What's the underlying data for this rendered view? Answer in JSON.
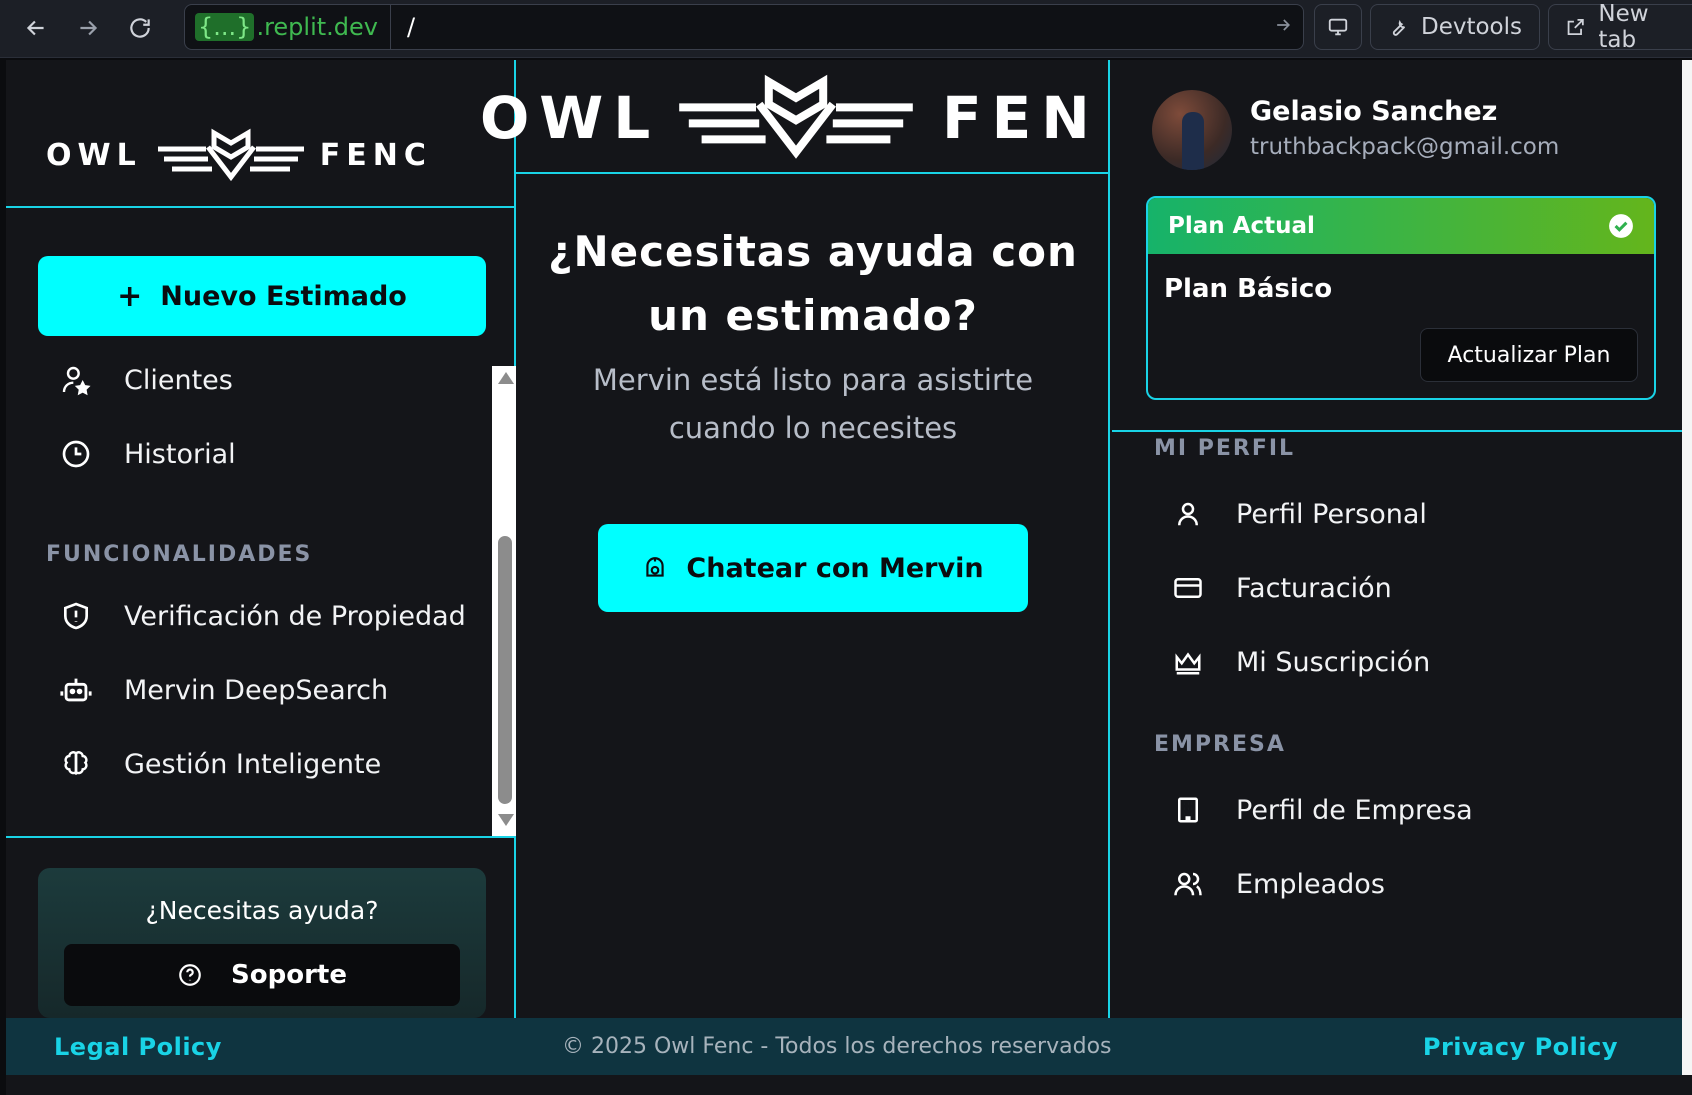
{
  "browser": {
    "url_badge": "{...}",
    "url_domain": ".replit.dev",
    "url_path": "/",
    "devtools_label": "Devtools",
    "newtab_label": "New tab"
  },
  "brand": {
    "logo_left_a": "OWL",
    "logo_left_b": "FENC",
    "logo_mid_a": "OWL",
    "logo_mid_b": "FEN"
  },
  "sidebar": {
    "new_estimate": "Nuevo Estimado",
    "items": [
      {
        "label": "Clientes",
        "icon": "user-star-icon"
      },
      {
        "label": "Historial",
        "icon": "clock-icon"
      }
    ],
    "section_label": "FUNCIONALIDADES",
    "features": [
      {
        "label": "Verificación de Propiedad",
        "icon": "shield-icon"
      },
      {
        "label": "Mervin DeepSearch",
        "icon": "robot-icon"
      },
      {
        "label": "Gestión Inteligente",
        "icon": "brain-icon"
      }
    ],
    "help_title": "¿Necesitas ayuda?",
    "support_label": "Soporte"
  },
  "main": {
    "title": "¿Necesitas ayuda con un estimado?",
    "subtitle": "Mervin está listo para asistirte cuando lo necesites",
    "chat_button": "Chatear con Mervin"
  },
  "profile": {
    "name": "Gelasio Sanchez",
    "email": "truthbackpack@gmail.com",
    "plan_header": "Plan Actual",
    "plan_name": "Plan Básico",
    "upgrade_button": "Actualizar Plan",
    "section_profile": "MI PERFIL",
    "profile_items": [
      {
        "label": "Perfil Personal",
        "icon": "user-icon"
      },
      {
        "label": "Facturación",
        "icon": "credit-card-icon"
      },
      {
        "label": "Mi Suscripción",
        "icon": "crown-icon"
      }
    ],
    "section_company": "EMPRESA",
    "company_items": [
      {
        "label": "Perfil de Empresa",
        "icon": "building-icon"
      },
      {
        "label": "Empleados",
        "icon": "users-icon"
      }
    ]
  },
  "footer": {
    "legal": "Legal Policy",
    "copyright": "© 2025 Owl Fenc - Todos los derechos reservados",
    "privacy": "Privacy Policy"
  },
  "colors": {
    "accent": "#00ffff",
    "border": "#19d3e6",
    "background": "#141519",
    "plan_green": "#16b36a"
  }
}
